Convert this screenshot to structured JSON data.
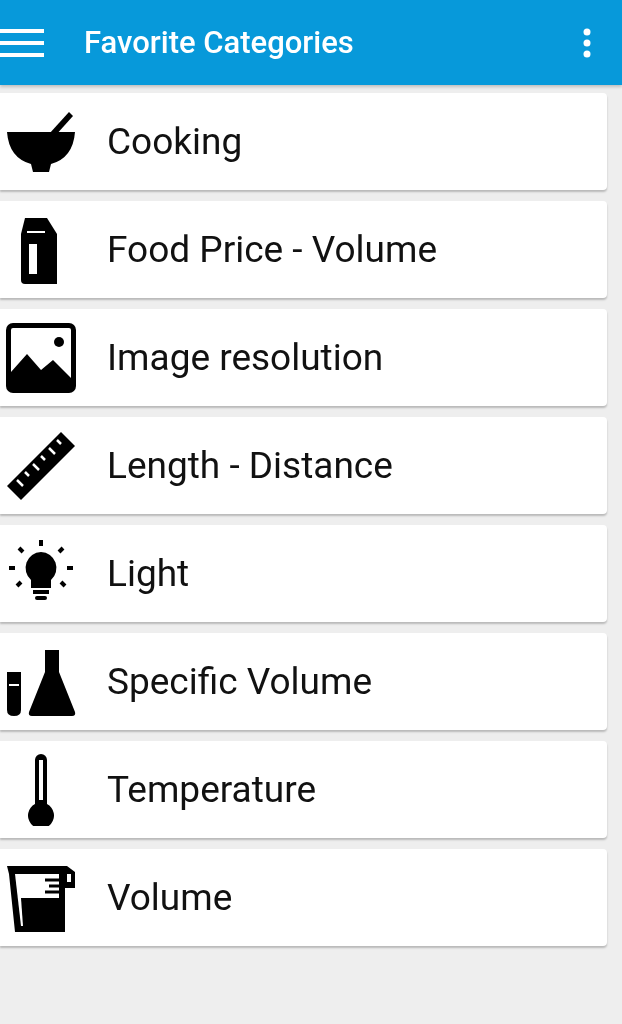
{
  "app_bar": {
    "title": "Favorite Categories"
  },
  "categories": [
    {
      "label": "Cooking"
    },
    {
      "label": "Food Price - Volume"
    },
    {
      "label": "Image resolution"
    },
    {
      "label": "Length - Distance"
    },
    {
      "label": "Light"
    },
    {
      "label": "Specific Volume"
    },
    {
      "label": "Temperature"
    },
    {
      "label": "Volume"
    }
  ]
}
